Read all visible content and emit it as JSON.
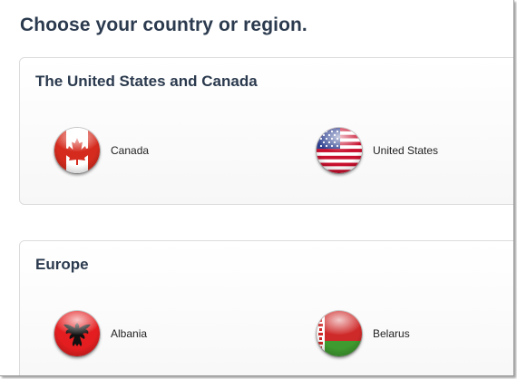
{
  "page": {
    "title": "Choose your country or region."
  },
  "regions": [
    {
      "name": "The United States and Canada",
      "countries": [
        {
          "label": "Canada",
          "flag_icon": "canada-flag-icon"
        },
        {
          "label": "United States",
          "flag_icon": "united-states-flag-icon"
        }
      ]
    },
    {
      "name": "Europe",
      "countries": [
        {
          "label": "Albania",
          "flag_icon": "albania-flag-icon"
        },
        {
          "label": "Belarus",
          "flag_icon": "belarus-flag-icon"
        }
      ]
    }
  ],
  "colors": {
    "heading": "#2b3a4e",
    "panel_border": "#dcdcdc",
    "flag_red": "#d52b1e",
    "us_blue": "#2b3f8f",
    "belarus_green": "#3f9a2f"
  }
}
